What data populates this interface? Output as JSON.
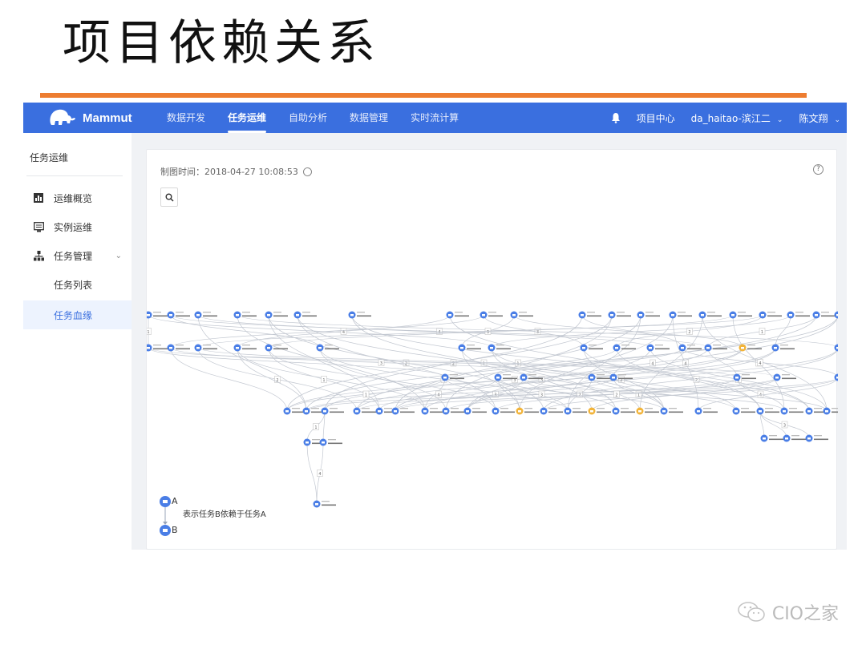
{
  "slide": {
    "title": "项目依赖关系",
    "accent_color": "#ed7d31"
  },
  "app": {
    "brand": "Mammut",
    "brand_color": "#3a6fdf",
    "nav": [
      {
        "label": "数据开发",
        "active": false
      },
      {
        "label": "任务运维",
        "active": true
      },
      {
        "label": "自助分析",
        "active": false
      },
      {
        "label": "数据管理",
        "active": false
      },
      {
        "label": "实时流计算",
        "active": false
      }
    ],
    "topright": {
      "bell_icon": "bell-icon",
      "project_center": "项目中心",
      "project": "da_haitao-滨江二",
      "user": "陈文翔"
    }
  },
  "sidebar": {
    "title": "任务运维",
    "items": [
      {
        "label": "运维概览",
        "icon": "bar-chart-icon"
      },
      {
        "label": "实例运维",
        "icon": "monitor-icon"
      },
      {
        "label": "任务管理",
        "icon": "org-tree-icon",
        "expandable": true
      },
      {
        "label": "任务列表",
        "sub": true
      },
      {
        "label": "任务血缘",
        "sub": true,
        "selected": true
      }
    ]
  },
  "panel": {
    "draw_time_label": "制图时间：",
    "draw_time": "2018-04-27 10:08:53",
    "help": "?",
    "legend": {
      "node_a": "A",
      "node_b": "B",
      "description": "表示任务B依赖于任务A"
    }
  },
  "graph": {
    "node_colors": {
      "normal": "#4a7ee6",
      "warning": "#f2b43a"
    },
    "rows": [
      {
        "level": 0,
        "count": 22
      },
      {
        "level": 1,
        "count": 17
      },
      {
        "level": 2,
        "count": 11
      },
      {
        "level": 3,
        "count": 28
      },
      {
        "level": 4,
        "count": 7
      },
      {
        "level": 5,
        "count": 2
      }
    ],
    "edge_labels": [
      "1",
      "2",
      "3",
      "4"
    ]
  },
  "footer": {
    "watermark": "CIO之家"
  }
}
